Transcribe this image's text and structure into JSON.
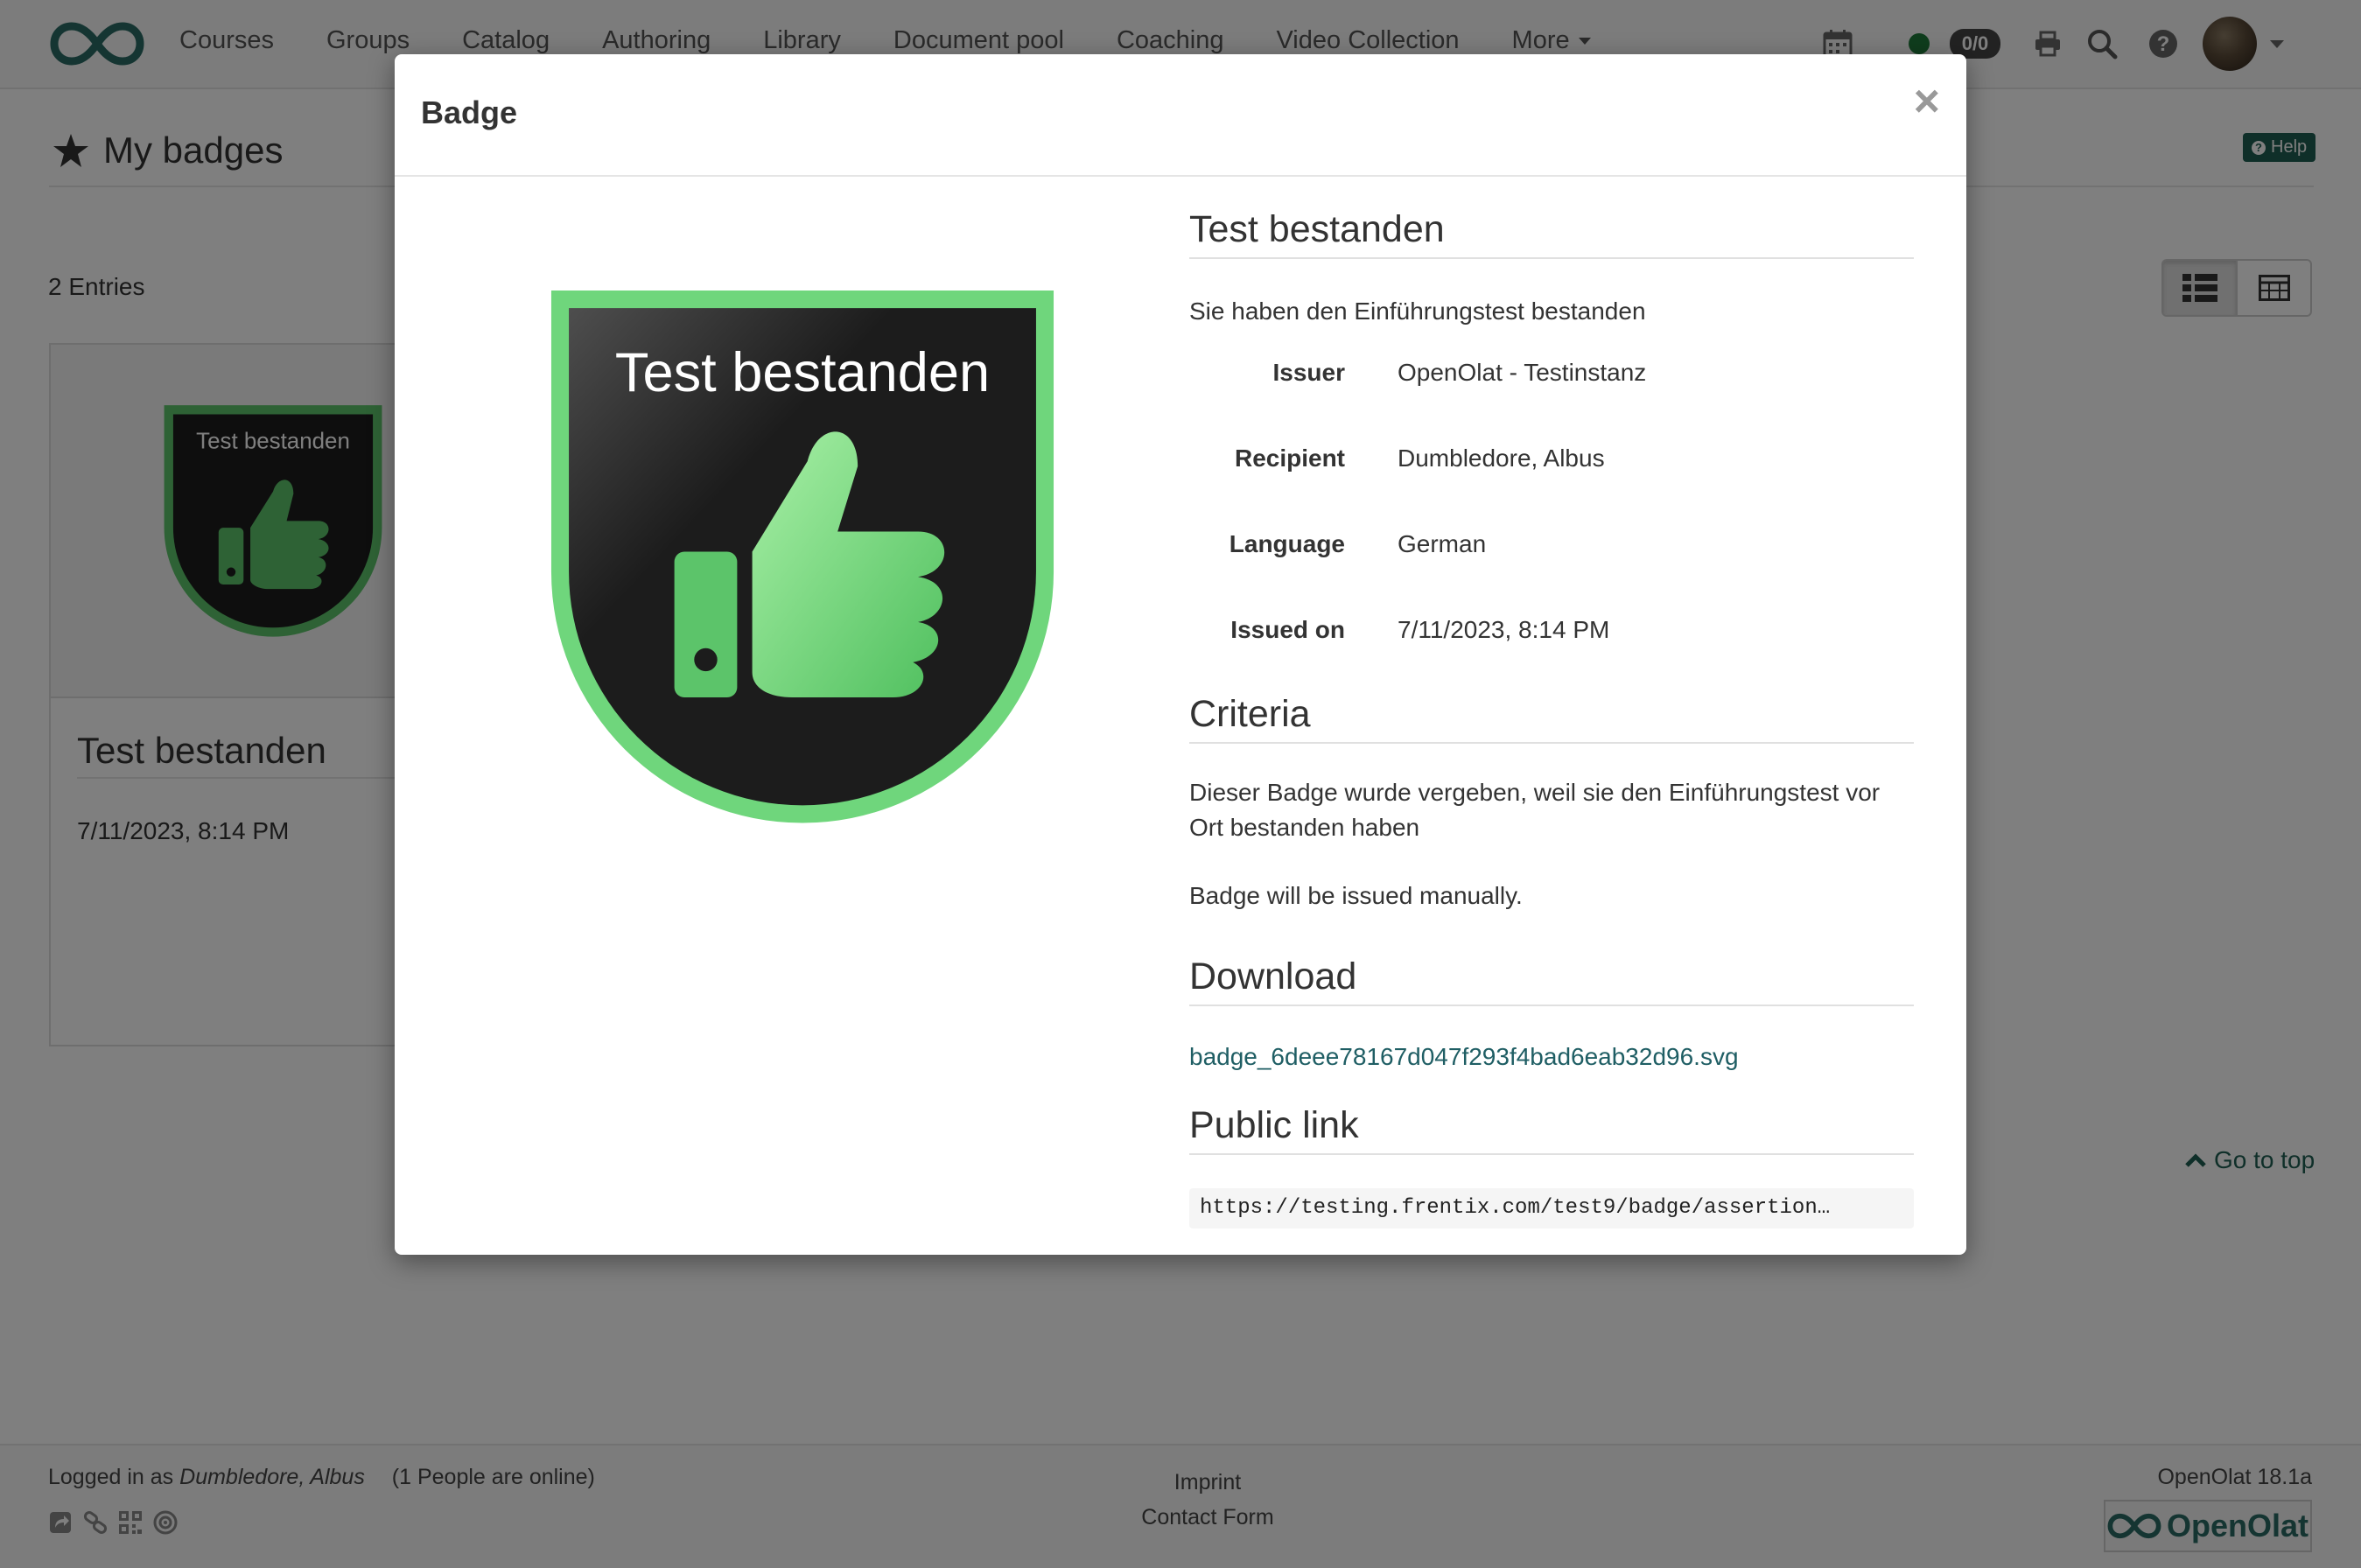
{
  "nav": {
    "items": [
      "Courses",
      "Groups",
      "Catalog",
      "Authoring",
      "Library",
      "Document pool",
      "Coaching",
      "Video Collection"
    ],
    "more_label": "More",
    "message_count": "0/0"
  },
  "page": {
    "title": "My badges",
    "help_label": "Help",
    "entries": "2 Entries",
    "card": {
      "badge_text": "Test bestanden",
      "title": "Test bestanden",
      "date": "7/11/2023, 8:14 PM"
    },
    "go_to_top": "Go to top"
  },
  "modal": {
    "title": "Badge",
    "badge_text": "Test bestanden",
    "name": "Test bestanden",
    "description": "Sie haben den Einführungstest bestanden",
    "fields": [
      {
        "label": "Issuer",
        "value": "OpenOlat - Testinstanz"
      },
      {
        "label": "Recipient",
        "value": "Dumbledore, Albus"
      },
      {
        "label": "Language",
        "value": "German"
      },
      {
        "label": "Issued on",
        "value": "7/11/2023, 8:14 PM"
      }
    ],
    "criteria_heading": "Criteria",
    "criteria_text": "Dieser Badge wurde vergeben, weil sie den Einführungstest vor Ort bestanden haben",
    "criteria_note": "Badge will be issued manually.",
    "download_heading": "Download",
    "download_file": "badge_6deee78167d047f293f4bad6eab32d96.svg",
    "public_link_heading": "Public link",
    "public_link": "https://testing.frentix.com/test9/badge/assertion…"
  },
  "footer": {
    "logged_in_prefix": "Logged in as",
    "user": "Dumbledore, Albus",
    "online": "(1 People are online)",
    "imprint": "Imprint",
    "contact": "Contact Form",
    "version": "OpenOlat 18.1a",
    "brand": "OpenOlat"
  },
  "colors": {
    "accent": "#1f5e52",
    "badge_green": "#6fd67c",
    "badge_dark": "#1c1c1c"
  }
}
